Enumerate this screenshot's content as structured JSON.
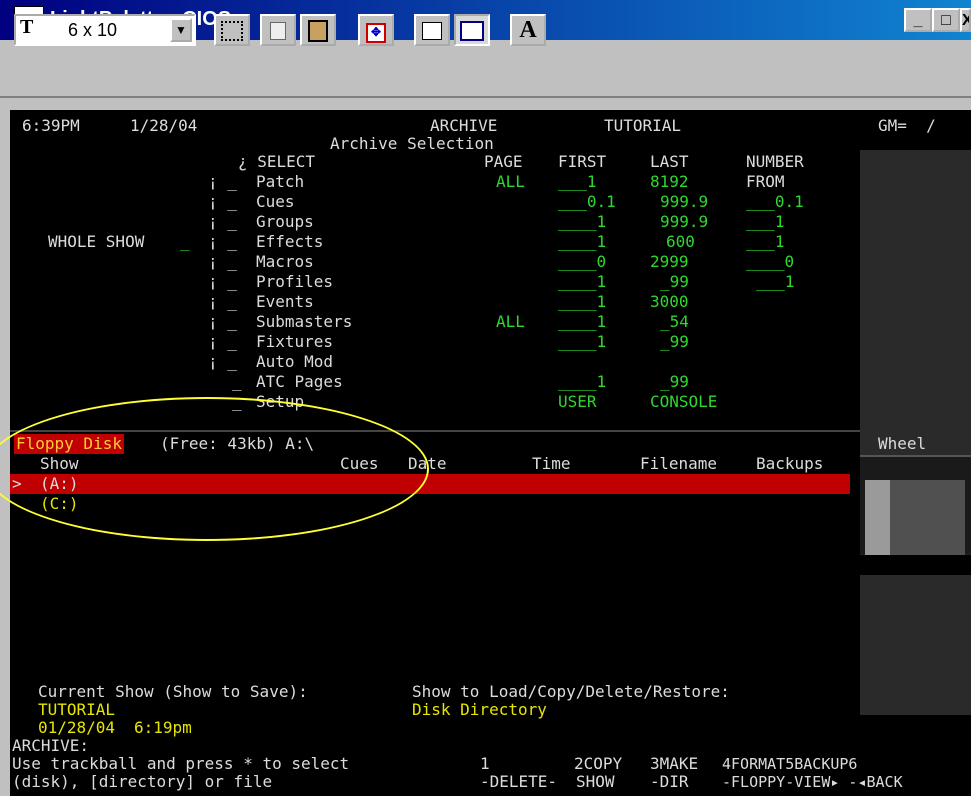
{
  "window": {
    "title": "LightPalette - CIOS",
    "controls": {
      "minimize": "_",
      "maximize": "□",
      "close": "X"
    },
    "icon_label": "MS"
  },
  "toolbar": {
    "font_icon": "T",
    "font_size": "6 x 10",
    "text_tool": "A"
  },
  "terminal": {
    "time": "6:39PM",
    "date": "1/28/04",
    "mode": "ARCHIVE",
    "show": "TUTORIAL",
    "gm": "GM=  /",
    "subtitle": "Archive Selection",
    "headers": {
      "select": "¿ SELECT",
      "page": "PAGE",
      "first": "FIRST",
      "last": "LAST",
      "number": "NUMBER",
      "from": "FROM"
    },
    "whole_show": "WHOLE SHOW",
    "rows": [
      {
        "label": "Patch",
        "page": "ALL",
        "first": "1",
        "last": "8192",
        "number": ""
      },
      {
        "label": "Cues",
        "page": "",
        "first": "0.1",
        "last": "999.9",
        "number": "0.1"
      },
      {
        "label": "Groups",
        "page": "",
        "first": "1",
        "last": "999.9",
        "number": "1"
      },
      {
        "label": "Effects",
        "page": "",
        "first": "1",
        "last": "600",
        "number": "1"
      },
      {
        "label": "Macros",
        "page": "",
        "first": "0",
        "last": "2999",
        "number": "0"
      },
      {
        "label": "Profiles",
        "page": "",
        "first": "1",
        "last": "99",
        "number": "1"
      },
      {
        "label": "Events",
        "page": "",
        "first": "1",
        "last": "3000",
        "number": ""
      },
      {
        "label": "Submasters",
        "page": "ALL",
        "first": "1",
        "last": "54",
        "number": ""
      },
      {
        "label": "Fixtures",
        "page": "",
        "first": "1",
        "last": "99",
        "number": ""
      },
      {
        "label": "Auto Mod",
        "page": "",
        "first": "",
        "last": "",
        "number": ""
      },
      {
        "label": "ATC Pages",
        "page": "",
        "first": "1",
        "last": "99",
        "number": ""
      },
      {
        "label": "Setup",
        "page": "",
        "first": "USER",
        "last": "CONSOLE",
        "number": ""
      }
    ],
    "disk": {
      "label": "Floppy Disk",
      "info": "(Free: 43kb) A:\\",
      "columns": {
        "show": "Show",
        "cues": "Cues",
        "date": "Date",
        "time": "Time",
        "filename": "Filename",
        "backups": "Backups"
      },
      "entries": [
        "(A:)",
        "(C:)"
      ],
      "cursor": ">"
    },
    "wheel_label": "Wheel",
    "current_show_label": "Current Show (Show to Save):",
    "current_show_name": "TUTORIAL",
    "current_show_date": "01/28/04",
    "current_show_time": "6:19pm",
    "load_label": "Show to Load/Copy/Delete/Restore:",
    "load_value": "Disk Directory",
    "prompt": "ARCHIVE:",
    "help_line1": "Use trackball and press * to select",
    "help_line2": "(disk), [directory] or file",
    "softkeys": {
      "k1_num": "1",
      "k1": "-DELETE-",
      "k2_num": "2COPY",
      "k2": "SHOW",
      "k3_num": "3MAKE",
      "k3": "-DIR",
      "k4_num": "4FORMAT5BACKUP6",
      "k4": "-FLOPPY-VIEW▸ -◂BACK"
    }
  }
}
